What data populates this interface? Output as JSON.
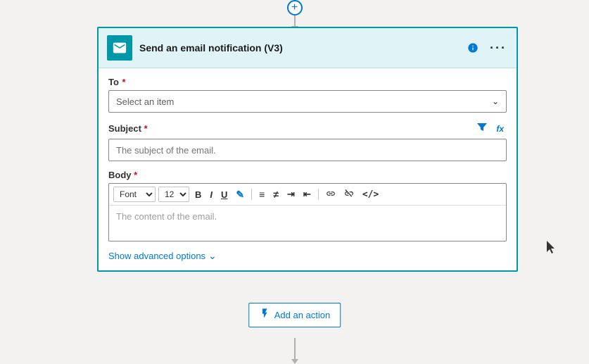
{
  "connector": {
    "plus_symbol": "+"
  },
  "card": {
    "title": "Send an email notification (V3)",
    "icon_alt": "email-icon"
  },
  "fields": {
    "to": {
      "label": "To",
      "required": true,
      "placeholder": "Select an item"
    },
    "subject": {
      "label": "Subject",
      "required": true,
      "placeholder": "The subject of the email."
    },
    "body": {
      "label": "Body",
      "required": true,
      "placeholder": "The content of the email.",
      "toolbar": {
        "font": "Font",
        "font_size": "12",
        "bold": "B",
        "italic": "I",
        "underline": "U"
      }
    }
  },
  "advanced": {
    "label": "Show advanced options"
  },
  "bottom_action": {
    "label": "Add an action"
  }
}
